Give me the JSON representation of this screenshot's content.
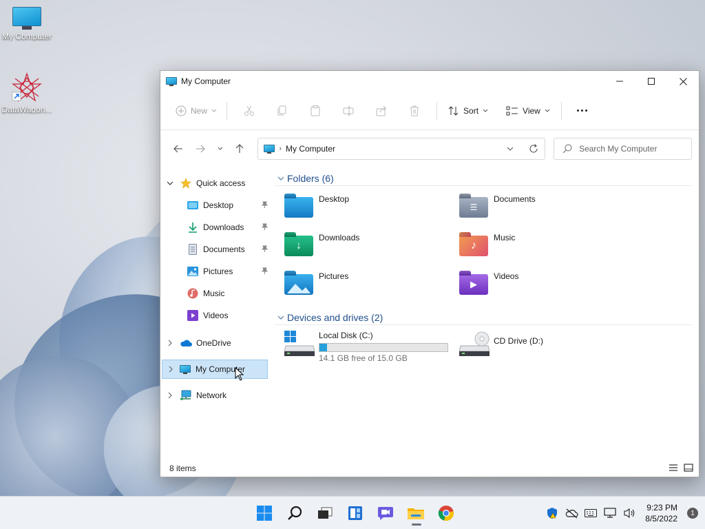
{
  "desktop": {
    "icons": [
      {
        "label": "My Computer"
      },
      {
        "label": "DataWagon..."
      }
    ]
  },
  "window": {
    "title": "My Computer",
    "toolbar": {
      "new_label": "New",
      "sort_label": "Sort",
      "view_label": "View"
    },
    "address": {
      "crumb": "My Computer"
    },
    "search": {
      "placeholder": "Search My Computer"
    },
    "sidebar": {
      "quick_access": "Quick access",
      "quick_items": [
        {
          "label": "Desktop",
          "pinned": true
        },
        {
          "label": "Downloads",
          "pinned": true
        },
        {
          "label": "Documents",
          "pinned": true
        },
        {
          "label": "Pictures",
          "pinned": true
        },
        {
          "label": "Music",
          "pinned": false
        },
        {
          "label": "Videos",
          "pinned": false
        }
      ],
      "onedrive": "OneDrive",
      "mycomputer": "My Computer",
      "network": "Network"
    },
    "content": {
      "folders_header": "Folders (6)",
      "folders": [
        {
          "name": "Desktop"
        },
        {
          "name": "Documents"
        },
        {
          "name": "Downloads"
        },
        {
          "name": "Music"
        },
        {
          "name": "Pictures"
        },
        {
          "name": "Videos"
        }
      ],
      "drives_header": "Devices and drives (2)",
      "drives": [
        {
          "name": "Local Disk (C:)",
          "free_text": "14.1 GB free of 15.0 GB",
          "used_fraction": 0.06
        },
        {
          "name": "CD Drive (D:)"
        }
      ]
    },
    "status": {
      "items_count": "8 items"
    }
  },
  "taskbar": {
    "time": "9:23 PM",
    "date": "8/5/2022",
    "notification_count": "1"
  },
  "colors": {
    "accent": "#0078d4",
    "selection": "#cce4f7",
    "drive_fill": "#26a0da",
    "group_header": "#1f4e8c"
  }
}
